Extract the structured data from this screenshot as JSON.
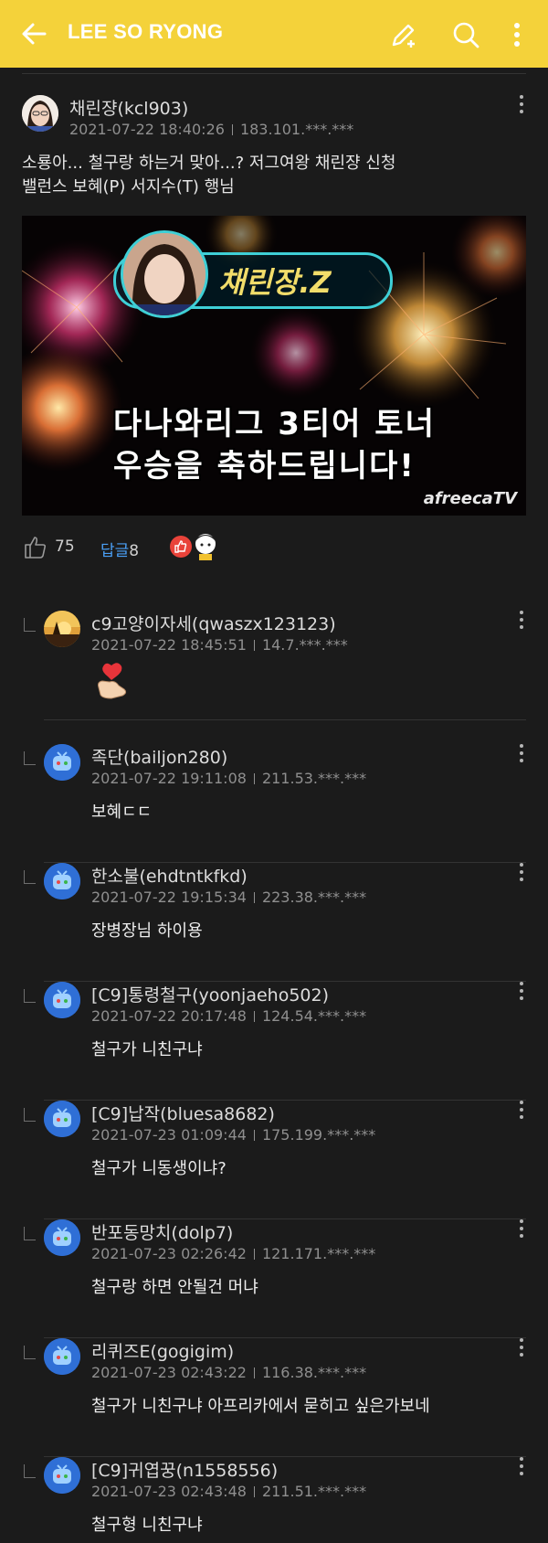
{
  "topbar": {
    "title": "LEE SO RYONG",
    "icons": [
      "back-arrow-icon",
      "write-icon",
      "search-icon",
      "more-vertical-icon"
    ],
    "bg_color": "#f4d23a"
  },
  "post": {
    "author": "채린쟝(kcl903)",
    "datetime": "2021-07-22 18:40:26",
    "ip": "183.101.***.***",
    "body_line1": "소룡아... 철구랑 하는거 맞아...? 저그여왕 채린쟝 신청",
    "body_line2": "밸런스 보혜(P) 서지수(T) 행님",
    "image": {
      "name_tag": "채린장.Z",
      "caption_line1": "다나와리그 3티어 토너",
      "caption_line2": "우승을 축하드립니다!",
      "watermark": "afreecaTV"
    },
    "like_count": "75",
    "reply_label": "답글",
    "reply_count": "8"
  },
  "comments": [
    {
      "author": "c9고양이자세(qwaszx123123)",
      "datetime": "2021-07-22 18:45:51",
      "ip": "14.7.***.***",
      "text": "",
      "avatar": "sunset",
      "sticker": "heart-hand-sticker"
    },
    {
      "author": "족단(bailjon280)",
      "datetime": "2021-07-22 19:11:08",
      "ip": "211.53.***.***",
      "text": "보혜ㄷㄷ",
      "avatar": "afreeca"
    },
    {
      "author": "한소불(ehdtntkfkd)",
      "datetime": "2021-07-22 19:15:34",
      "ip": "223.38.***.***",
      "text": "장병장님 하이용",
      "avatar": "afreeca"
    },
    {
      "author": "[C9]통령철구(yoonjaeho502)",
      "datetime": "2021-07-22 20:17:48",
      "ip": "124.54.***.***",
      "text": "철구가 니친구냐",
      "avatar": "afreeca"
    },
    {
      "author": "[C9]납작(bluesa8682)",
      "datetime": "2021-07-23 01:09:44",
      "ip": "175.199.***.***",
      "text": "철구가 니동생이냐?",
      "avatar": "afreeca"
    },
    {
      "author": "반포동망치(dolp7)",
      "datetime": "2021-07-23 02:26:42",
      "ip": "121.171.***.***",
      "text": "철구랑 하면 안될건 머냐",
      "avatar": "afreeca"
    },
    {
      "author": "리퀴즈E(gogigim)",
      "datetime": "2021-07-23 02:43:22",
      "ip": "116.38.***.***",
      "text": "철구가 니친구냐 아프리카에서 묻히고 싶은가보네",
      "avatar": "afreeca"
    },
    {
      "author": "[C9]귀엽꿍(n1558556)",
      "datetime": "2021-07-23 02:43:48",
      "ip": "211.51.***.***",
      "text": "철구형 니친구냐",
      "avatar": "afreeca"
    }
  ]
}
